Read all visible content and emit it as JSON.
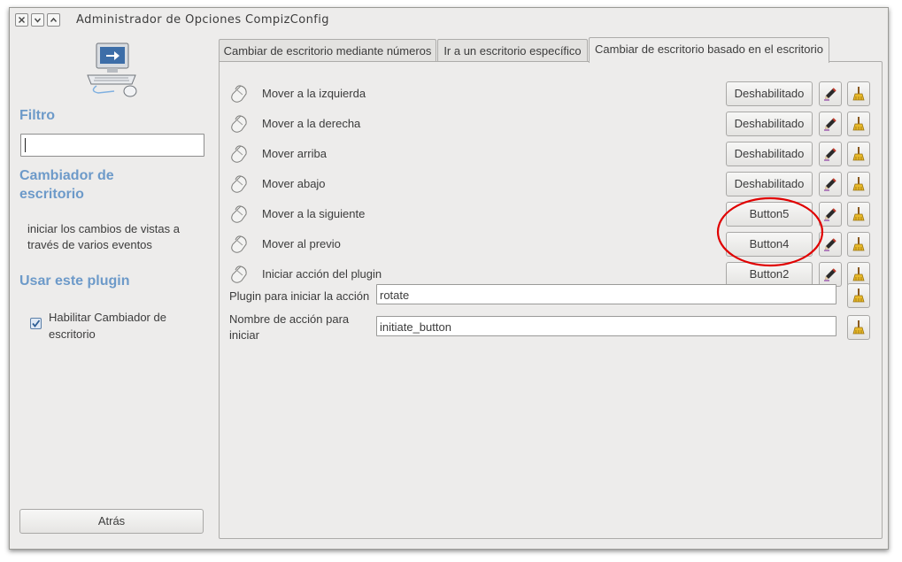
{
  "window": {
    "title": "Administrador de Opciones CompizConfig"
  },
  "sidebar": {
    "filter_heading": "Filtro",
    "filter_value": "",
    "plugin_heading": "Cambiador de escritorio",
    "description": "iniciar los cambios de vistas a través de varios eventos",
    "use_plugin_heading": "Usar este plugin",
    "enable_checkbox": {
      "label": "Habilitar Cambiador de escritorio",
      "checked": true
    },
    "back_button": "Atrás"
  },
  "tabs": [
    {
      "label": "Cambiar de escritorio mediante números",
      "active": false
    },
    {
      "label": "Ir a un escritorio específico",
      "active": false
    },
    {
      "label": "Cambiar de escritorio basado en el escritorio",
      "active": true
    }
  ],
  "bindings": [
    {
      "label": "Mover a la izquierda",
      "value": "Deshabilitado"
    },
    {
      "label": "Mover a la derecha",
      "value": "Deshabilitado"
    },
    {
      "label": "Mover arriba",
      "value": "Deshabilitado"
    },
    {
      "label": "Mover abajo",
      "value": "Deshabilitado"
    },
    {
      "label": "Mover a la siguiente",
      "value": "Button5"
    },
    {
      "label": "Mover al previo",
      "value": "Button4"
    },
    {
      "label": "Iniciar acción del plugin",
      "value": "Button2"
    }
  ],
  "fields": [
    {
      "label": "Plugin para iniciar la acción",
      "value": "rotate"
    },
    {
      "label": "Nombre de acción para iniciar",
      "value": "initiate_button"
    }
  ],
  "icons": {
    "edit": "pencil-icon",
    "reset": "broom-icon",
    "binding_type": "mouse-icon",
    "plugin_logo": "computer-icon"
  },
  "colors": {
    "heading": "#6d9ac9",
    "annotation": "#e00000"
  }
}
